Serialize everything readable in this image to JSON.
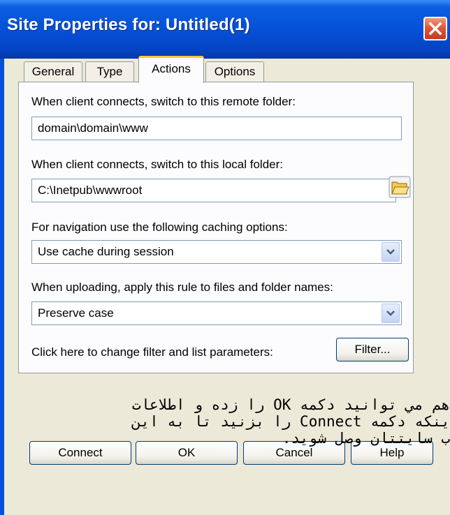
{
  "window": {
    "title": "Site Properties for: Untitled(1)"
  },
  "tabs": [
    {
      "label": "General"
    },
    {
      "label": "Type"
    },
    {
      "label": "Actions"
    },
    {
      "label": "Options"
    }
  ],
  "actions": {
    "remote_folder_label": "When client connects, switch to this remote folder:",
    "remote_folder_value": "domain\\domain\\www",
    "local_folder_label": "When client connects, switch to this local folder:",
    "local_folder_value": "C:\\Inetpub\\wwwroot",
    "caching_label": "For navigation use the following caching options:",
    "caching_value": "Use cache during session",
    "upload_rule_label": "When uploading, apply this rule to files and folder names:",
    "upload_rule_value": "Preserve case",
    "filter_label": "Click here to change filter and list parameters:",
    "filter_button": "Filter..."
  },
  "buttons": {
    "connect": "Connect",
    "ok": "OK",
    "cancel": "Cancel",
    "help": "Help"
  },
  "overlay_text": {
    "line1": "هم مي توانيد دكمه OK را زده و اطلاعات",
    "line2": "ينكه دكمه Connect را بزنيد تا به اين",
    "line3": "ب سايتتان وصل شويد."
  },
  "icons": {
    "close": "close-icon",
    "folder": "open-folder-icon",
    "dropdown": "chevron-down-icon"
  }
}
